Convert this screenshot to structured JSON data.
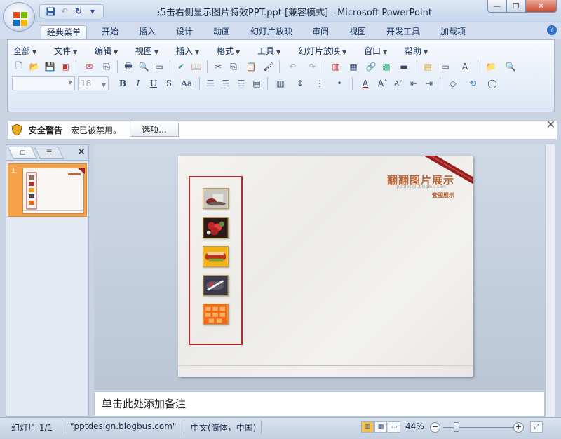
{
  "window": {
    "title": "点击右侧显示图片特效PPT.ppt [兼容模式] - Microsoft PowerPoint",
    "controls": {
      "minimize": "—",
      "maximize": "☐",
      "close": "✕"
    }
  },
  "quick_access": {
    "save_icon": "save-icon",
    "undo_icon": "undo-icon",
    "redo_icon": "redo-icon",
    "customize_icon": "customize-qat-icon"
  },
  "ribbon_tabs": [
    "经典菜单",
    "开始",
    "插入",
    "设计",
    "动画",
    "幻灯片放映",
    "审阅",
    "视图",
    "开发工具",
    "加载项"
  ],
  "active_tab": "经典菜单",
  "help_label": "?",
  "classic_menu": [
    "全部",
    "文件",
    "编辑",
    "视图",
    "插入",
    "格式",
    "工具",
    "幻灯片放映",
    "窗口",
    "帮助"
  ],
  "font": {
    "name": "",
    "size": "18"
  },
  "security_bar": {
    "title": "安全警告",
    "message": "宏已被禁用。",
    "options_button": "选项..."
  },
  "slides_panel": {
    "slide_number": "1"
  },
  "slide": {
    "title": "翻翻图片展示",
    "url": "pptdesign.blogbus.com",
    "subtitle": "套图展示"
  },
  "notes_placeholder": "单击此处添加备注",
  "status": {
    "slide_info": "幻灯片 1/1",
    "theme": "\"pptdesign.blogbus.com\"",
    "language": "中文(简体，中国)",
    "zoom": "44%",
    "zoom_level": 0.44
  },
  "colors": {
    "accent": "#f6a24a",
    "frame": "#b52a2a",
    "slide_title": "#b9673a"
  }
}
